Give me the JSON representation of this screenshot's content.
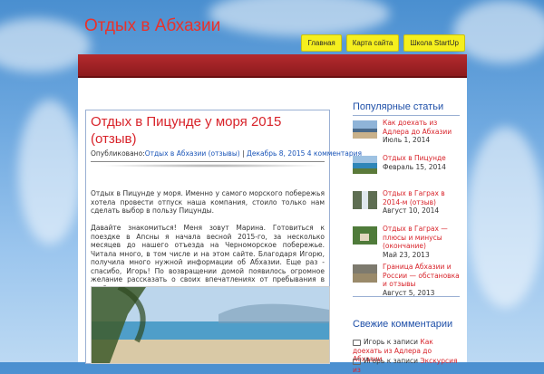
{
  "site": {
    "title": "Отдых в Абхазии"
  },
  "nav": {
    "items": [
      {
        "label": "Главная"
      },
      {
        "label": "Карта сайта"
      },
      {
        "label": "Школа StartUp"
      }
    ]
  },
  "post": {
    "title": "Отдых в Пицунде у моря 2015 (отзыв)",
    "meta_prefix": "Опубликовано:",
    "category": "Отдых в Абхазии (отзывы)",
    "separator": " | ",
    "date": "Декабрь 8, 2015",
    "comments": "4 комментария",
    "paragraph1": "Отдых в Пицунде у моря. Именно у самого морского побережья хотела провести отпуск наша компания, стоило только нам сделать выбор в пользу Пицунды.",
    "paragraph2": "Давайте знакомиться! Меня зовут Марина. Готовиться к поездке в Апсны я начала весной 2015-го, за несколько месяцев до нашего отъезда на Черноморское побережье. Читала много, в том числе и на этом сайте. Благодаря Игорю, получила много нужной информации об Абхазии. Еще раз - спасибо, Игорь! По возвращении домой появилось огромное желание рассказать о своих впечатлениях от пребывания в этой стране."
  },
  "sidebar": {
    "popular_title": "Популярные статьи",
    "popular": [
      {
        "title": "Как доехать из Адлера до Абхазии",
        "date": "Июль 1, 2014",
        "thumb": "beach-crowd"
      },
      {
        "title": "Отдых в Пицунде",
        "date": "Февраль 15, 2014",
        "thumb": "coast"
      },
      {
        "title": "Отдых в Гаграх в 2014-м (отзыв)",
        "date": "Август 10, 2014",
        "thumb": "waterfall"
      },
      {
        "title": "Отдых в Гаграх — плюсы и минусы (окончание)",
        "date": "Май 23, 2013",
        "thumb": "hills"
      },
      {
        "title": "Граница Абхазии и России — обстановка и отзывы",
        "date": "Август 5, 2013",
        "thumb": "border"
      }
    ],
    "comments_title": "Свежие комментарии",
    "comments": [
      {
        "author": "Игорь",
        "prefix": " к записи ",
        "target": "Как доехать из Адлера до Абхазии"
      },
      {
        "author": "Игорь",
        "prefix": " к записи ",
        "target": "Экскурсия из"
      }
    ]
  },
  "colors": {
    "accent_red": "#d8232a",
    "link_blue": "#1a55b8",
    "nav_yellow": "#f5ef1e",
    "banner_red": "#9e2225"
  }
}
